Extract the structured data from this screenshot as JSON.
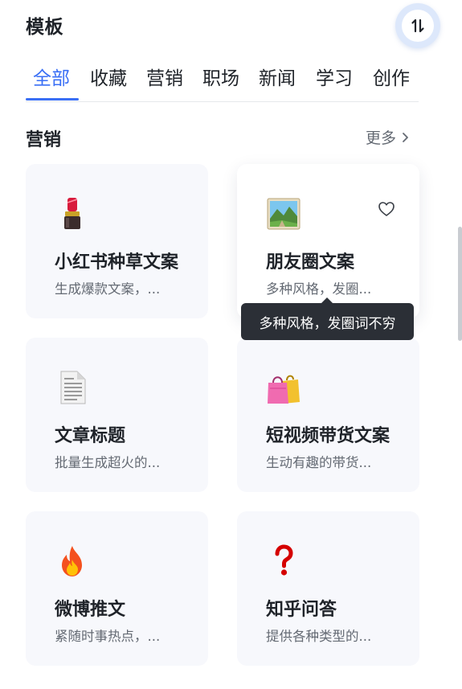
{
  "header": {
    "title": "模板",
    "sort_icon": "sort-arrows-icon"
  },
  "tabs": [
    {
      "label": "全部",
      "active": true
    },
    {
      "label": "收藏",
      "active": false
    },
    {
      "label": "营销",
      "active": false
    },
    {
      "label": "职场",
      "active": false
    },
    {
      "label": "新闻",
      "active": false
    },
    {
      "label": "学习",
      "active": false
    },
    {
      "label": "创作",
      "active": false
    }
  ],
  "section": {
    "title": "营销",
    "more_label": "更多",
    "more_icon": "chevron-right-icon"
  },
  "cards": [
    {
      "name": "小红书种草文案",
      "desc": "生成爆款文案，...",
      "icon": "lipstick-icon"
    },
    {
      "name": "朋友圈文案",
      "desc": "多种风格，发圈...",
      "icon": "landscape-picture-icon",
      "favorite_icon": "heart-icon"
    },
    {
      "name": "文章标题",
      "desc": "批量生成超火的...",
      "icon": "document-icon"
    },
    {
      "name": "短视频带货文案",
      "desc": "生动有趣的带货...",
      "icon": "shopping-bags-icon"
    },
    {
      "name": "微博推文",
      "desc": "紧随时事热点，...",
      "icon": "fire-icon"
    },
    {
      "name": "知乎问答",
      "desc": "提供各种类型的...",
      "icon": "question-mark-icon"
    }
  ],
  "tooltip": {
    "text": "多种风格，发圈词不穷"
  },
  "colors": {
    "accent": "#3a6ff5",
    "card_bg": "#f7f8fc",
    "tooltip_bg": "#2b2f36"
  }
}
